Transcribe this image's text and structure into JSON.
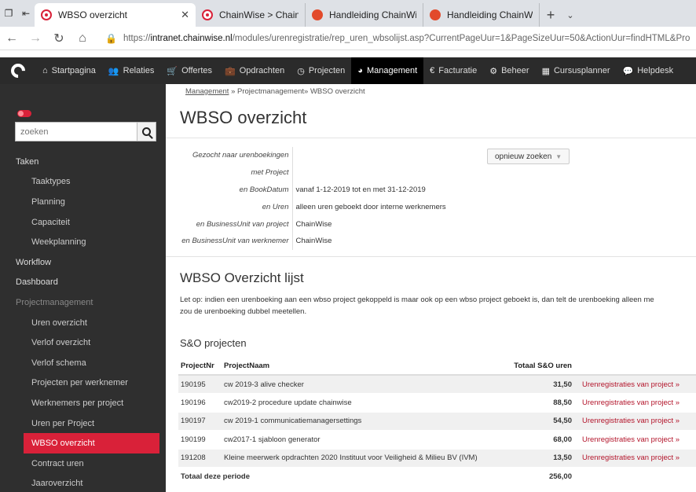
{
  "browser": {
    "tabs": [
      {
        "title": "WBSO overzicht",
        "icon": "chainwise-icon",
        "active": true
      },
      {
        "title": "ChainWise > ChainWise be",
        "icon": "chainwise-icon",
        "active": false
      },
      {
        "title": "Handleiding ChainWise Cur",
        "icon": "document-icon",
        "active": false
      },
      {
        "title": "Handleiding ChainWise Alg",
        "icon": "document-icon",
        "active": false
      }
    ],
    "url_prefix": "https://",
    "url_host": "intranet.chainwise.nl",
    "url_path": "/modules/urenregistratie/rep_uren_wbsolijst.asp?CurrentPageUur=1&PageSizeUur=50&ActionUur=findHTML&Pro"
  },
  "nav": {
    "items": [
      {
        "label": "Startpagina",
        "icon": "home-icon"
      },
      {
        "label": "Relaties",
        "icon": "people-icon"
      },
      {
        "label": "Offertes",
        "icon": "cart-icon"
      },
      {
        "label": "Opdrachten",
        "icon": "briefcase-icon"
      },
      {
        "label": "Projecten",
        "icon": "clock-icon"
      },
      {
        "label": "Management",
        "icon": "piechart-icon"
      },
      {
        "label": "Facturatie",
        "icon": "euro-icon"
      },
      {
        "label": "Beheer",
        "icon": "gears-icon"
      },
      {
        "label": "Cursusplanner",
        "icon": "calendar-icon"
      },
      {
        "label": "Helpdesk",
        "icon": "chat-icon"
      }
    ],
    "active": "Management"
  },
  "sidebar": {
    "search_placeholder": "zoeken",
    "items": [
      {
        "label": "Taken",
        "level": "top"
      },
      {
        "label": "Taaktypes",
        "level": "sub"
      },
      {
        "label": "Planning",
        "level": "sub"
      },
      {
        "label": "Capaciteit",
        "level": "sub"
      },
      {
        "label": "Weekplanning",
        "level": "sub"
      },
      {
        "label": "Workflow",
        "level": "top"
      },
      {
        "label": "Dashboard",
        "level": "top"
      },
      {
        "label": "Projectmanagement",
        "level": "section"
      },
      {
        "label": "Uren overzicht",
        "level": "sub"
      },
      {
        "label": "Verlof overzicht",
        "level": "sub"
      },
      {
        "label": "Verlof schema",
        "level": "sub"
      },
      {
        "label": "Projecten per werknemer",
        "level": "sub"
      },
      {
        "label": "Werknemers per project",
        "level": "sub"
      },
      {
        "label": "Uren per Project",
        "level": "sub"
      },
      {
        "label": "WBSO overzicht",
        "level": "active"
      },
      {
        "label": "Contract uren",
        "level": "sub"
      },
      {
        "label": "Jaaroverzicht",
        "level": "sub"
      }
    ]
  },
  "breadcrumb": {
    "link": "Management",
    "rest": " » Projectmanagement» WBSO overzicht"
  },
  "page_title": "WBSO overzicht",
  "criteria": [
    {
      "key": "Gezocht naar urenboekingen",
      "value": ""
    },
    {
      "key": "met Project",
      "value": ""
    },
    {
      "key": "en BookDatum",
      "value": "vanaf 1-12-2019 tot en met 31-12-2019"
    },
    {
      "key": "en Uren",
      "value": "alleen uren geboekt door interne werknemers"
    },
    {
      "key": "en BusinessUnit van project",
      "value": "ChainWise"
    },
    {
      "key": "en BusinessUnit van werknemer",
      "value": "ChainWise"
    }
  ],
  "research_button": "opnieuw zoeken",
  "list_title": "WBSO Overzicht lijst",
  "note_line1": "Let op: indien een urenboeking aan een wbso project gekoppeld is maar ook op een wbso project geboekt is, dan telt de urenboeking alleen me",
  "note_line2": "zou de urenboeking dubbel meetellen.",
  "section_title": "S&O projecten",
  "table": {
    "headers": {
      "nr": "ProjectNr",
      "name": "ProjectNaam",
      "hours": "Totaal S&O uren",
      "link": ""
    },
    "rows": [
      {
        "nr": "190195",
        "name": "cw 2019-3 alive checker",
        "hours": "31,50",
        "link": "Urenregistraties van project »"
      },
      {
        "nr": "190196",
        "name": "cw2019-2 procedure update chainwise",
        "hours": "88,50",
        "link": "Urenregistraties van project »"
      },
      {
        "nr": "190197",
        "name": "cw 2019-1 communicatiemanagersettings",
        "hours": "54,50",
        "link": "Urenregistraties van project »"
      },
      {
        "nr": "190199",
        "name": "cw2017-1 sjabloon generator",
        "hours": "68,00",
        "link": "Urenregistraties van project »"
      },
      {
        "nr": "191208",
        "name": "Kleine meerwerk opdrachten 2020 Instituut voor Veiligheid & Milieu BV (IVM)",
        "hours": "13,50",
        "link": "Urenregistraties van project »"
      }
    ],
    "total_label": "Totaal deze periode",
    "total_value": "256,00"
  },
  "colors": {
    "accent": "#d92139",
    "sidebar": "#2f2f2f",
    "topnav": "#2b2b2b"
  }
}
